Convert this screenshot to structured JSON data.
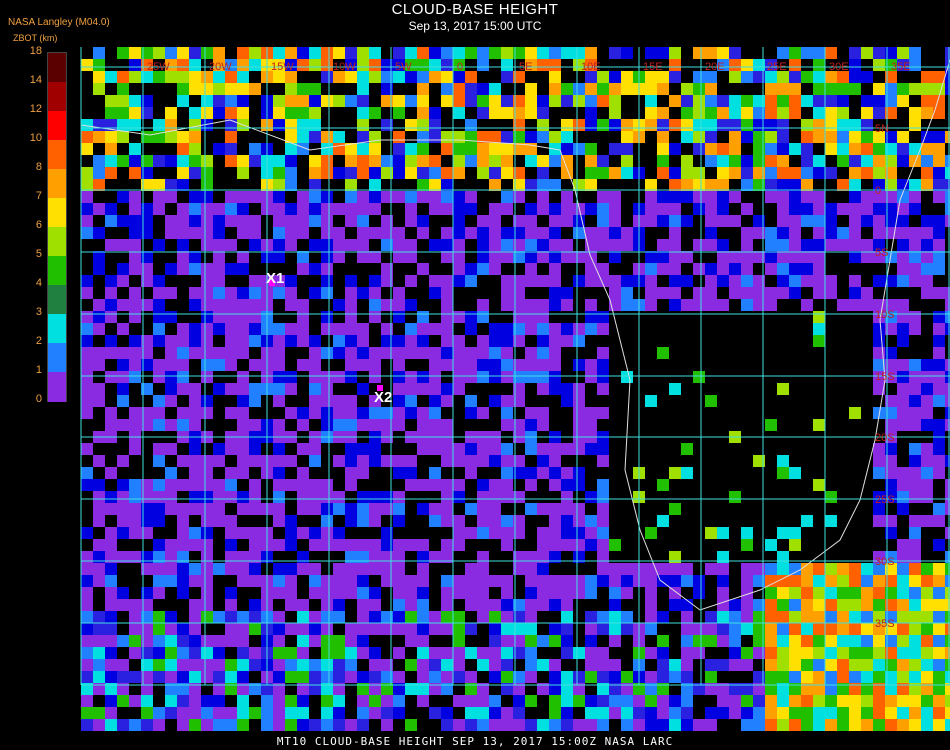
{
  "header": {
    "title": "CLOUD-BASE HEIGHT",
    "subtitle": "Sep 13, 2017 15:00 UTC",
    "org": "NASA Langley (M04.0)",
    "param": "ZBOT (km)"
  },
  "legend": {
    "ticks": [
      "18",
      "14",
      "12",
      "10",
      "8",
      "7",
      "6",
      "5",
      "4",
      "3",
      "2",
      "1",
      "0"
    ],
    "colors": [
      "#5a0000",
      "#a00000",
      "#ff0000",
      "#ff6000",
      "#ffa000",
      "#ffe000",
      "#a0e000",
      "#20c000",
      "#208040",
      "#00e0e0",
      "#2080ff",
      "#0000e0",
      "#8a2be2"
    ]
  },
  "map": {
    "lon_labels": [
      "25W",
      "20W",
      "15W",
      "10W",
      "5W",
      "0",
      "5E",
      "10E",
      "15E",
      "20E",
      "25E",
      "30E",
      "35E"
    ],
    "lat_labels": [
      "5N",
      "0",
      "5S",
      "10S",
      "15S",
      "20S",
      "25S",
      "30S",
      "35S"
    ],
    "markers": [
      {
        "label": "X1",
        "lon": "-16",
        "lat": "-4"
      },
      {
        "label": "X2",
        "lon": "-6",
        "lat": "-16"
      }
    ],
    "grid_color": "#40e0e0",
    "label_color": "#c02020"
  },
  "footer": "MT10  CLOUD-BASE HEIGHT   SEP 13, 2017 15:00Z   NASA LARC"
}
